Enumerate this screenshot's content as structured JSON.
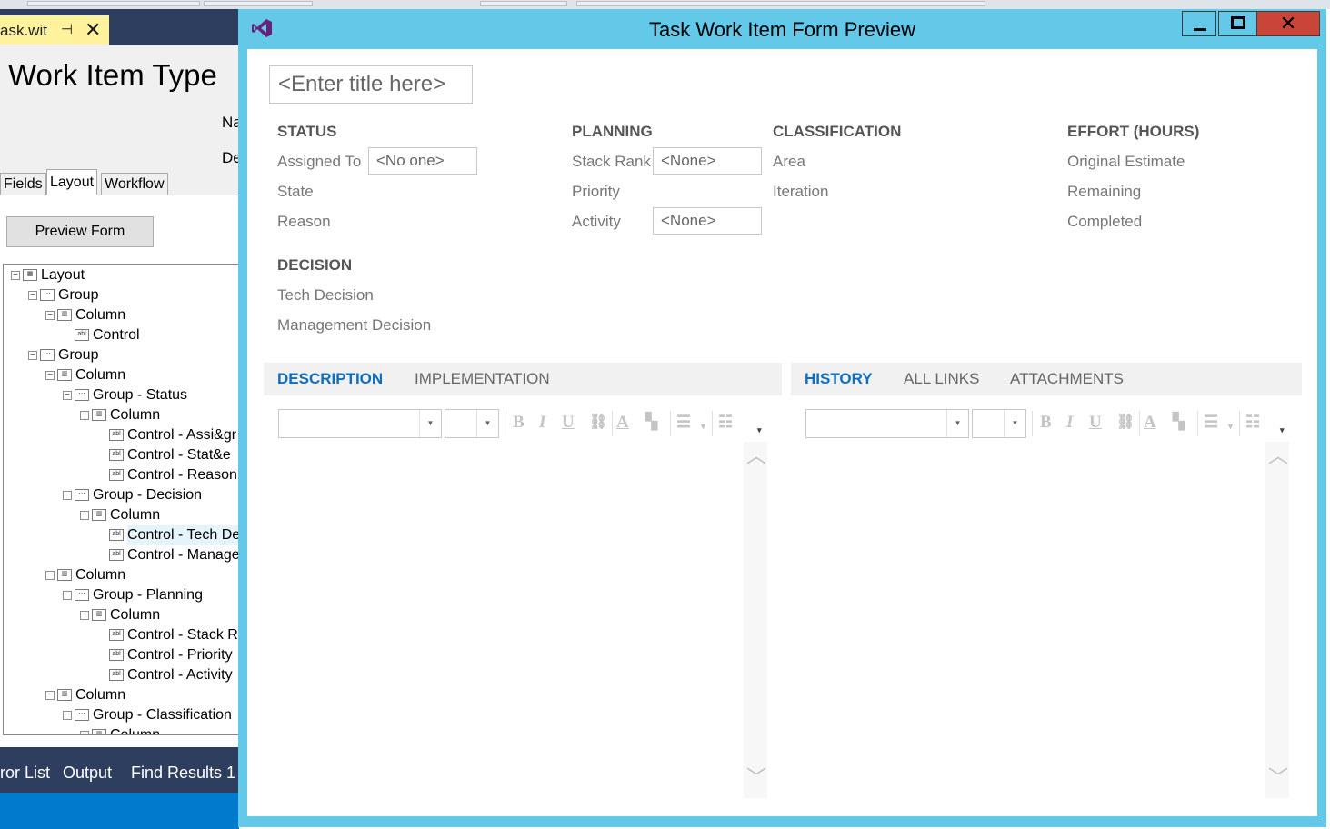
{
  "colors": {
    "accent": "#106ebe",
    "window_chrome": "#64c8e8",
    "ide_dark": "#2d3e5f",
    "statusbar": "#007acc",
    "doc_tab": "#fff29d",
    "close": "#c9453a"
  },
  "doc_tab": {
    "name": "ask.wit",
    "pin_icon": "pin-icon",
    "close_glyph": "✕"
  },
  "editor": {
    "title": "Work Item Type",
    "label_name": "Na",
    "label_desc": "De",
    "tabs": [
      "Fields",
      "Layout",
      "Workflow"
    ],
    "preview_button": "Preview Form",
    "tree": [
      {
        "label": "Layout",
        "icon": "layout-icon",
        "expander": "−"
      },
      {
        "label": "Group",
        "icon": "group-icon",
        "expander": "−"
      },
      {
        "label": "Column",
        "icon": "column-icon",
        "expander": "−"
      },
      {
        "label": "Control",
        "icon": "control-icon",
        "expander": ""
      },
      {
        "label": "Group",
        "icon": "group-icon",
        "expander": "−"
      },
      {
        "label": "Column",
        "icon": "column-icon",
        "expander": "−"
      },
      {
        "label": "Group - Status",
        "icon": "group-icon",
        "expander": "−"
      },
      {
        "label": "Column",
        "icon": "column-icon",
        "expander": "−"
      },
      {
        "label": "Control - Assi&gr",
        "icon": "control-icon",
        "expander": ""
      },
      {
        "label": "Control - Stat&e",
        "icon": "control-icon",
        "expander": ""
      },
      {
        "label": "Control - Reason",
        "icon": "control-icon",
        "expander": ""
      },
      {
        "label": "Group - Decision",
        "icon": "group-icon",
        "expander": "−"
      },
      {
        "label": "Column",
        "icon": "column-icon",
        "expander": "−"
      },
      {
        "label": "Control - Tech De",
        "icon": "control-icon",
        "expander": ""
      },
      {
        "label": "Control - Manage",
        "icon": "control-icon",
        "expander": ""
      },
      {
        "label": "Column",
        "icon": "column-icon",
        "expander": "−"
      },
      {
        "label": "Group - Planning",
        "icon": "group-icon",
        "expander": "−"
      },
      {
        "label": "Column",
        "icon": "column-icon",
        "expander": "−"
      },
      {
        "label": "Control - Stack R",
        "icon": "control-icon",
        "expander": ""
      },
      {
        "label": "Control - Priority",
        "icon": "control-icon",
        "expander": ""
      },
      {
        "label": "Control - Activity",
        "icon": "control-icon",
        "expander": ""
      },
      {
        "label": "Column",
        "icon": "column-icon",
        "expander": "−"
      },
      {
        "label": "Group - Classification",
        "icon": "group-icon",
        "expander": "−"
      },
      {
        "label": "Column",
        "icon": "column-icon",
        "expander": "−"
      }
    ],
    "bottom_tabs": [
      "ror List",
      "Output",
      "Find Results 1"
    ]
  },
  "preview": {
    "window_title": "Task Work Item Form Preview",
    "window_buttons": {
      "minimize": "—",
      "maximize": "☐",
      "close": "✕"
    },
    "title_placeholder": "<Enter title here>",
    "sections": {
      "status": {
        "heading": "STATUS",
        "fields": [
          "Assigned To",
          "State",
          "Reason"
        ],
        "assigned_value": "<No one>"
      },
      "planning": {
        "heading": "PLANNING",
        "fields": [
          "Stack Rank",
          "Priority",
          "Activity"
        ],
        "stack_rank_value": "<None>",
        "activity_value": "<None>"
      },
      "classification": {
        "heading": "CLASSIFICATION",
        "fields": [
          "Area",
          "Iteration"
        ]
      },
      "effort": {
        "heading": "EFFORT (HOURS)",
        "fields": [
          "Original Estimate",
          "Remaining",
          "Completed"
        ]
      },
      "decision": {
        "heading": "DECISION",
        "fields": [
          "Tech Decision",
          "Management Decision"
        ]
      }
    },
    "left_tabs": [
      {
        "label": "DESCRIPTION",
        "active": true
      },
      {
        "label": "IMPLEMENTATION",
        "active": false
      }
    ],
    "right_tabs": [
      {
        "label": "HISTORY",
        "active": true
      },
      {
        "label": "ALL LINKS",
        "active": false
      },
      {
        "label": "ATTACHMENTS",
        "active": false
      }
    ],
    "rte_toolbar": {
      "bold": "B",
      "italic": "I",
      "underline": "U",
      "more": "▾"
    }
  }
}
